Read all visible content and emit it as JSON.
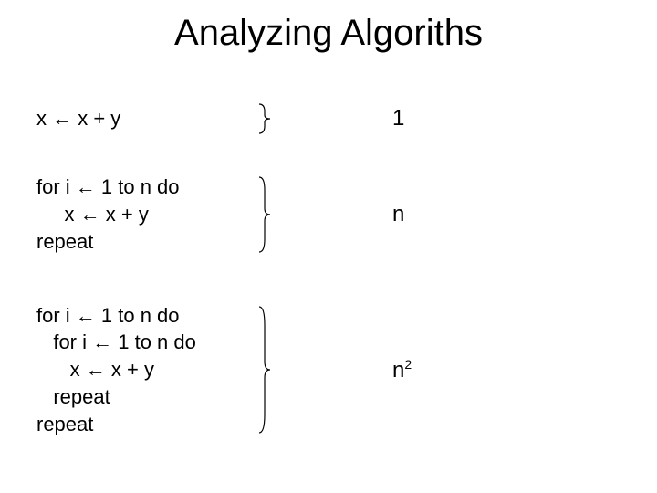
{
  "title": "Analyzing Algoriths",
  "blocks": {
    "b1": {
      "code": "x ← x + y",
      "complexity": "1"
    },
    "b2": {
      "code": "for i ← 1 to n do\n     x ← x + y\nrepeat",
      "complexity": "n"
    },
    "b3": {
      "code": "for i ← 1 to n do\n   for i ← 1 to n do\n      x ← x + y\n   repeat\nrepeat",
      "complexity_base": "n",
      "complexity_exp": "2"
    }
  }
}
